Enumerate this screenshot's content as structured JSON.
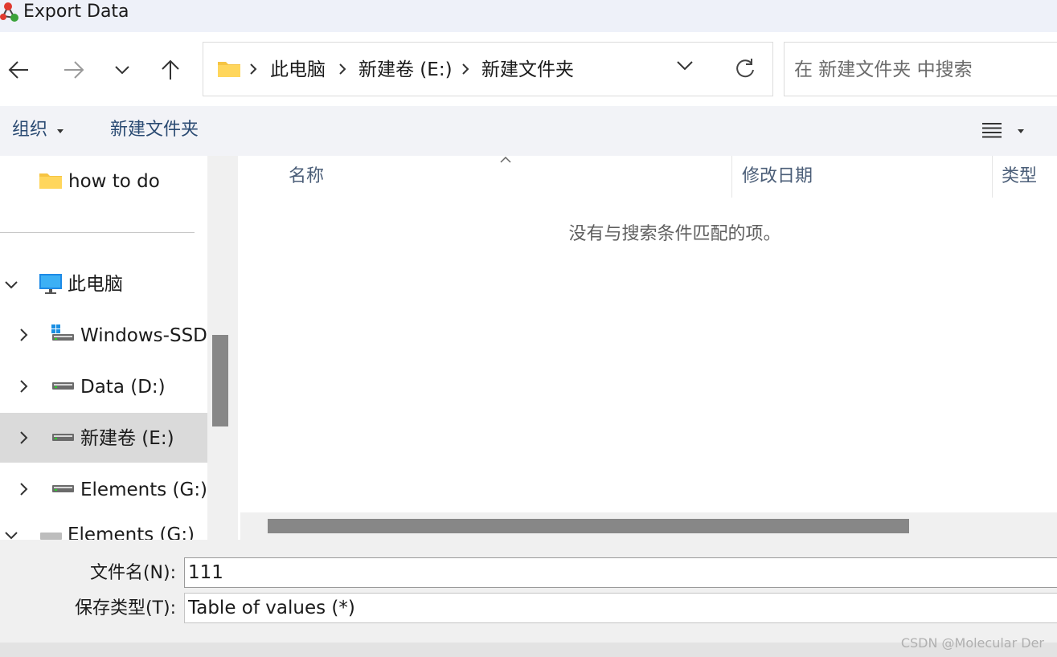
{
  "window": {
    "title": "Export Data",
    "app_icon": "molecule-icon"
  },
  "nav": {
    "back_icon": "arrow-left-icon",
    "forward_icon": "arrow-right-icon",
    "recent_icon": "chevron-down-icon",
    "up_icon": "arrow-up-icon"
  },
  "address": {
    "folder_icon": "folder-icon",
    "crumbs": [
      "此电脑",
      "新建卷 (E:)",
      "新建文件夹"
    ],
    "dropdown_icon": "chevron-down-icon",
    "refresh_icon": "refresh-icon"
  },
  "search": {
    "placeholder": "在 新建文件夹 中搜索"
  },
  "toolbar": {
    "organize_label": "组织",
    "new_folder_label": "新建文件夹",
    "view_icon": "list-view-icon"
  },
  "navpane": {
    "items": [
      {
        "label": "how to do",
        "icon": "folder-icon"
      },
      {
        "label": "此电脑",
        "icon": "computer-icon",
        "expanded": true
      },
      {
        "label": "Windows-SSD",
        "icon": "windows-drive-icon"
      },
      {
        "label": "Data (D:)",
        "icon": "drive-icon"
      },
      {
        "label": "新建卷 (E:)",
        "icon": "drive-icon",
        "selected": true
      },
      {
        "label": "Elements (G:)",
        "icon": "drive-icon"
      },
      {
        "label": "Elements (G:)",
        "icon": "drive-icon"
      }
    ]
  },
  "filelist": {
    "columns": [
      "名称",
      "修改日期",
      "类型"
    ],
    "empty_message": "没有与搜索条件匹配的项。"
  },
  "form": {
    "filename_label": "文件名(N):",
    "filename_value": "111",
    "filetype_label": "保存类型(T):",
    "filetype_value": "Table of values (*)"
  },
  "watermark": "CSDN @Molecular Der",
  "colors": {
    "accent_text": "#2a4a72",
    "selected_bg": "#dadada",
    "scrollbar": "#878787"
  }
}
